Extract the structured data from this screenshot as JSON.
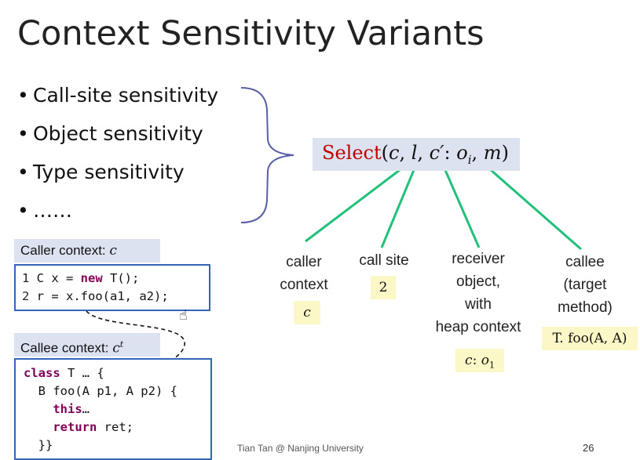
{
  "title": "Context Sensitivity Variants",
  "bullets": [
    "Call-site sensitivity",
    "Object sensitivity",
    "Type sensitivity",
    "……"
  ],
  "bullet_char": "•",
  "select": {
    "fn": "Select",
    "open": "(",
    "c": "c",
    "comma1": ", ",
    "l": "l",
    "comma2": ", ",
    "cprime": "c′",
    "colon": ": ",
    "o": "o",
    "o_sub": "i",
    "comma3": ", ",
    "m": "m",
    "close": ")"
  },
  "labels": {
    "caller": [
      "caller",
      "context"
    ],
    "callsite": [
      "call site"
    ],
    "receiver": [
      "receiver",
      "object,",
      "with",
      "heap context"
    ],
    "callee": [
      "callee",
      "(target",
      "method)"
    ]
  },
  "values": {
    "caller": "c",
    "callsite": "2",
    "receiver_c": "c",
    "receiver_colon": ": ",
    "receiver_o": "o",
    "receiver_sub": "1",
    "callee": "T. foo(A, A)"
  },
  "caller_context": {
    "label": "Caller context: ",
    "var": "c"
  },
  "callee_context": {
    "label": "Callee context: ",
    "var": "c",
    "sup": "t"
  },
  "caller_code": {
    "line1": {
      "num": "1",
      "pre": " C x = ",
      "kw": "new",
      "post": " T();"
    },
    "line2": {
      "num": "2",
      "text": " r = x.foo(a1, a2);"
    }
  },
  "callee_code": {
    "line1": {
      "kw": "class",
      "post": " T … {"
    },
    "line2": "  B foo(A p1, A p2) {",
    "line3": {
      "kw": "    this",
      "post": "…"
    },
    "line4": {
      "kw": "    return",
      "post": " ret;"
    },
    "line5": "  }}"
  },
  "footer": "Tian Tan @ Nanjing University",
  "page_number": "26",
  "colors": {
    "accent_red": "#c00000",
    "connector_green": "#22c07a",
    "brace_blue": "#5a5fa6",
    "code_border": "#3366bb",
    "label_bg": "#dde2f0",
    "value_bg": "#fbf7c6"
  }
}
